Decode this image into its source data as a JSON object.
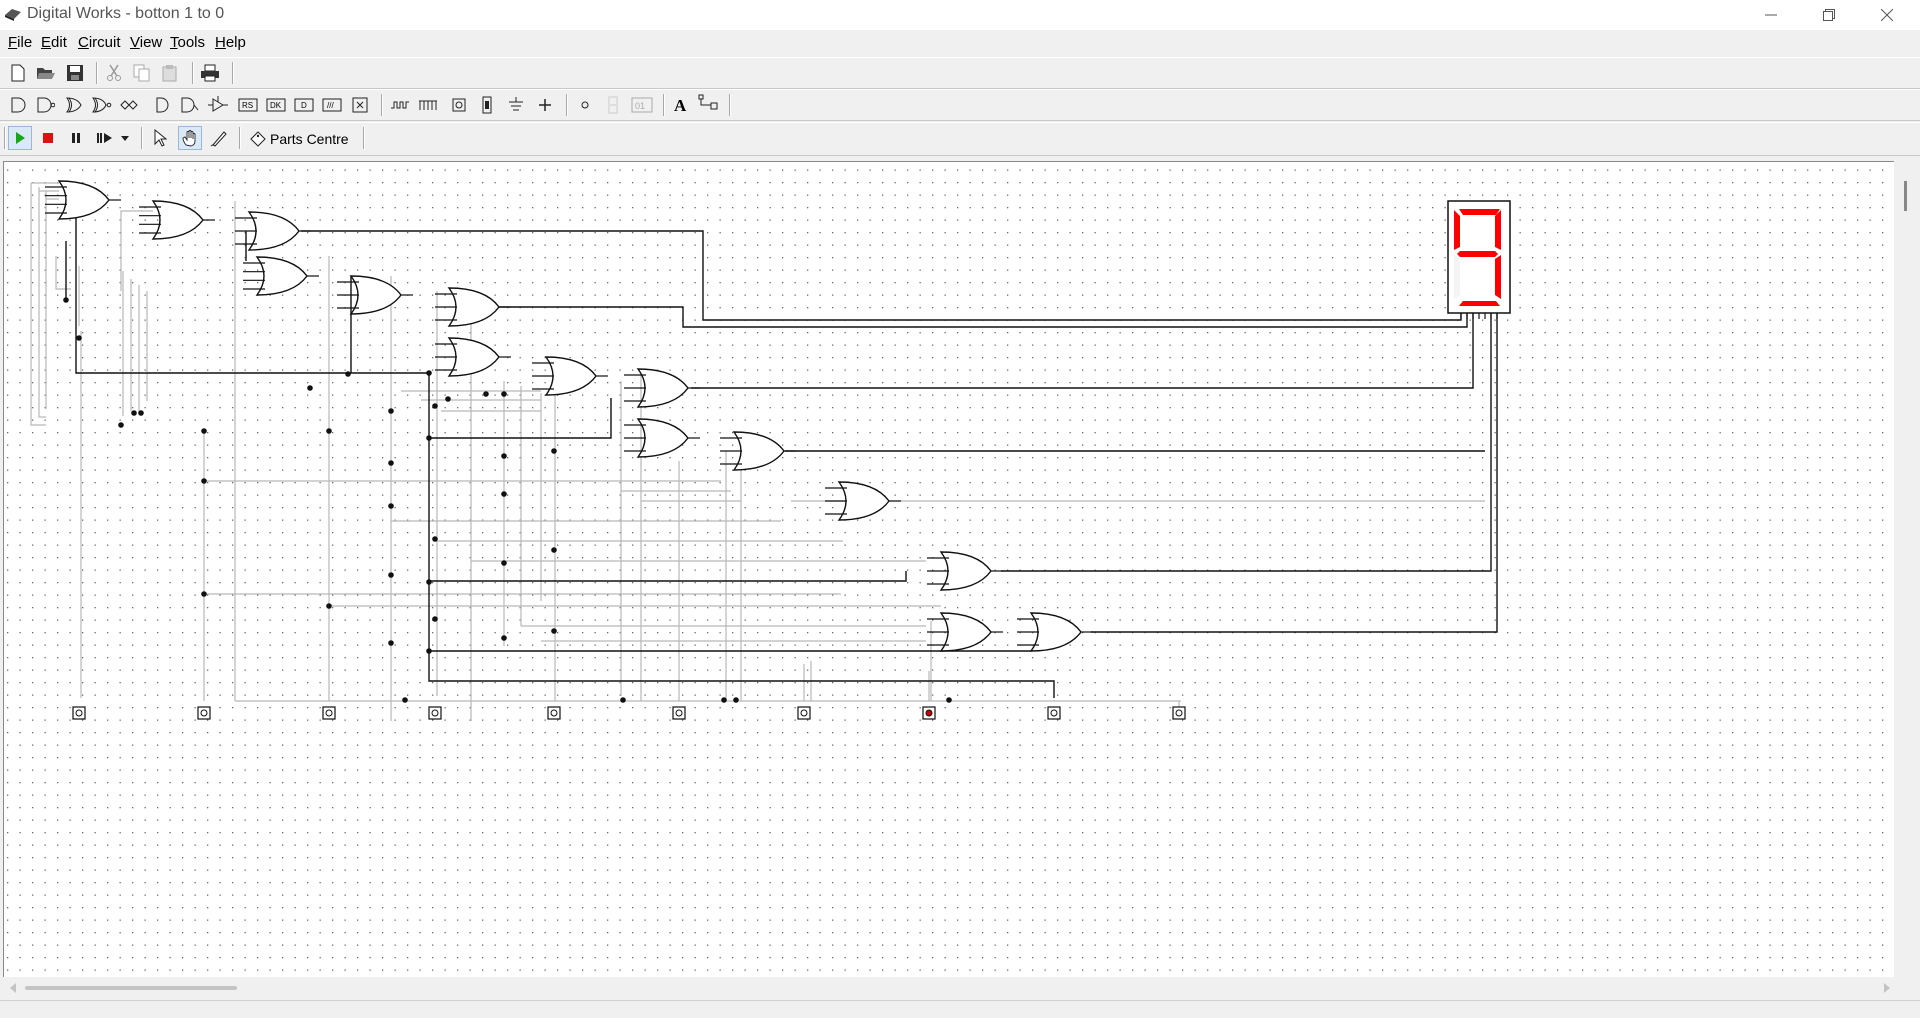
{
  "window": {
    "title": "Digital Works - botton 1 to 0"
  },
  "menu": [
    {
      "label": "File",
      "mnemonic": "F",
      "rest": "ile"
    },
    {
      "label": "Edit",
      "mnemonic": "E",
      "rest": "dit"
    },
    {
      "label": "Circuit",
      "mnemonic": "C",
      "rest": "ircuit"
    },
    {
      "label": "View",
      "mnemonic": "V",
      "rest": "iew"
    },
    {
      "label": "Tools",
      "mnemonic": "T",
      "rest": "ools"
    },
    {
      "label": "Help",
      "mnemonic": "H",
      "rest": "elp"
    }
  ],
  "toolbar": {
    "parts_centre_label": "Parts Centre"
  },
  "display": {
    "value": "9",
    "segment_color": "#ff0000"
  },
  "switches": {
    "count": 10,
    "active_index": 7,
    "active_color": "#d00000"
  },
  "icons": [
    "new-file-icon",
    "open-folder-icon",
    "save-icon",
    "cut-icon",
    "copy-icon",
    "paste-icon",
    "print-icon",
    "and-gate-icon",
    "nand-gate-icon",
    "or-gate-icon",
    "nor-gate-icon",
    "xor-gate-icon",
    "buffer-icon",
    "inverter-icon",
    "tristate-icon",
    "rs-flipflop-icon",
    "dk-flipflop-icon",
    "d-flipflop-icon",
    "jk-flipflop-icon",
    "macro-icon",
    "clock-icon",
    "pulse-icon",
    "switch-icon",
    "battery-icon",
    "ground-icon",
    "junction-icon",
    "led-icon",
    "seven-segment-icon",
    "hex-display-icon",
    "text-icon",
    "probe-icon",
    "run-icon",
    "stop-icon",
    "pause-icon",
    "step-icon",
    "step-dropdown-icon",
    "select-icon",
    "hand-icon",
    "wire-icon",
    "parts-centre-icon"
  ]
}
